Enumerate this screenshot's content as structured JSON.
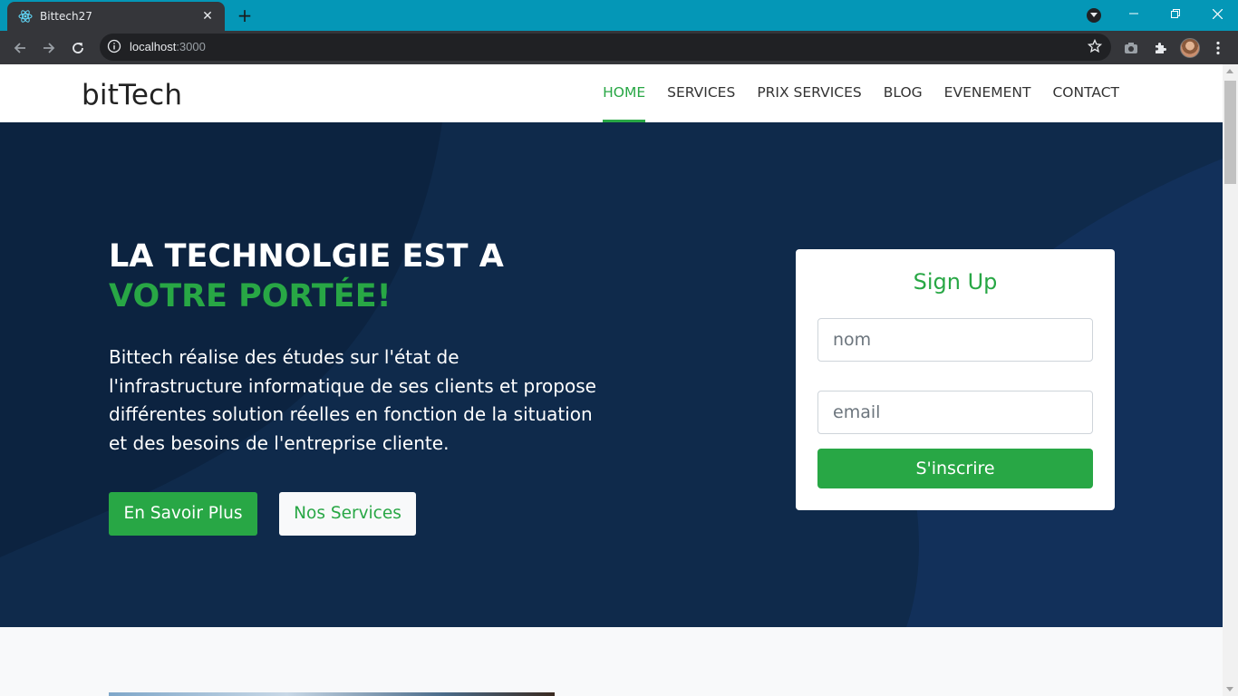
{
  "browser": {
    "tab_title": "Bittech27",
    "url_host": "localhost",
    "url_port": ":3000",
    "new_tab_label": "+",
    "close_tab_label": "✕"
  },
  "site": {
    "logo": "bitTech",
    "nav": [
      {
        "label": "HOME",
        "active": true
      },
      {
        "label": "SERVICES",
        "active": false
      },
      {
        "label": "PRIX SERVICES",
        "active": false
      },
      {
        "label": "BLOG",
        "active": false
      },
      {
        "label": "EVENEMENT",
        "active": false
      },
      {
        "label": "CONTACT",
        "active": false
      }
    ]
  },
  "hero": {
    "title_white": "LA TECHNOLGIE EST A ",
    "title_accent": "VOTRE PORTÉE!",
    "text": "Bittech réalise des études sur l'état de l'infrastructure informatique de ses clients et propose différentes solution réelles en fonction de la situation et des besoins de l'entreprise cliente.",
    "btn_primary": "En Savoir Plus",
    "btn_secondary": "Nos Services"
  },
  "signup": {
    "title": "Sign Up",
    "name_placeholder": "nom",
    "email_placeholder": "email",
    "submit": "S'inscrire"
  },
  "colors": {
    "accent": "#28a745",
    "hero_bg": "#0f2a4b",
    "browser_frame": "#0497b7"
  }
}
